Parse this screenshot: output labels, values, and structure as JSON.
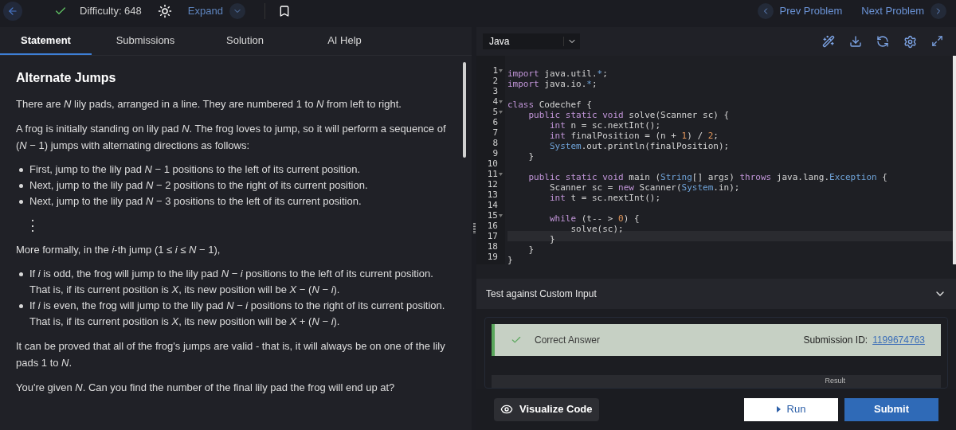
{
  "topbar": {
    "solved": true,
    "difficulty": "Difficulty: 648",
    "expand": "Expand",
    "prev": "Prev Problem",
    "next": "Next Problem"
  },
  "tabs": [
    {
      "label": "Statement",
      "selected": true
    },
    {
      "label": "Submissions",
      "selected": false
    },
    {
      "label": "Solution",
      "selected": false
    },
    {
      "label": "AI Help",
      "selected": false
    }
  ],
  "statement": {
    "title": "Alternate Jumps",
    "blocks": [
      {
        "kind": "p",
        "text": "There are *N* lily pads, arranged in a line. They are numbered 1 to *N* from left to right."
      },
      {
        "kind": "p",
        "text": "A frog is initially standing on lily pad *N*. The frog loves to jump, so it will perform a sequence of (*N* − 1) jumps with alternating directions as follows:"
      },
      {
        "kind": "list",
        "items": [
          "First, jump to the lily pad *N* − 1 positions to the left of its current position.",
          "Next, jump to the lily pad *N* − 2 positions to the right of its current position.",
          "Next, jump to the lily pad *N* − 3 positions to the left of its current position."
        ]
      },
      {
        "kind": "dots",
        "text": "⋮"
      },
      {
        "kind": "p",
        "text": "More formally, in the *i*-th jump (1 ≤ *i* ≤ *N* − 1),"
      },
      {
        "kind": "list",
        "items": [
          "If *i* is odd, the frog will jump to the lily pad *N* − *i* positions to the left of its current position. That is, if its current position is *X*, its new position will be *X* − (*N* − *i*).",
          "If *i* is even, the frog will jump to the lily pad *N* − *i* positions to the right of its current position. That is, if its current position is *X*, its new position will be *X* + (*N* − *i*)."
        ]
      },
      {
        "kind": "p",
        "text": "It can be proved that all of the frog's jumps are valid - that is, it will always be on one of the lily pads 1 to *N*."
      },
      {
        "kind": "p",
        "text": "You're given *N*. Can you find the number of the final lily pad the frog will end up at?"
      }
    ]
  },
  "editor": {
    "language": "Java",
    "lines": [
      {
        "n": "1",
        "fold": true,
        "current": false,
        "tokens": [
          {
            "kind": "kw",
            "t": "import"
          },
          {
            "kind": "plain",
            "t": " java.util."
          },
          {
            "kind": "type",
            "t": "*"
          },
          {
            "kind": "plain",
            "t": ";"
          }
        ]
      },
      {
        "n": "2",
        "fold": false,
        "current": false,
        "tokens": [
          {
            "kind": "kw",
            "t": "import"
          },
          {
            "kind": "plain",
            "t": " java.io."
          },
          {
            "kind": "type",
            "t": "*"
          },
          {
            "kind": "plain",
            "t": ";"
          }
        ]
      },
      {
        "n": "3",
        "fold": false,
        "current": false
      },
      {
        "n": "4",
        "fold": true,
        "current": false,
        "tokens": [
          {
            "kind": "kw",
            "t": "class"
          },
          {
            "kind": "plain",
            "t": " Codechef {"
          }
        ]
      },
      {
        "n": "5",
        "fold": true,
        "current": false,
        "tokens": [
          {
            "kind": "kw",
            "t": "    public static void"
          },
          {
            "kind": "plain",
            "t": " solve(Scanner sc) {"
          }
        ]
      },
      {
        "n": "6",
        "fold": false,
        "current": false,
        "tokens": [
          {
            "kind": "kw",
            "t": "        int"
          },
          {
            "kind": "plain",
            "t": " n = sc.nextInt();"
          }
        ]
      },
      {
        "n": "7",
        "fold": false,
        "current": false,
        "tokens": [
          {
            "kind": "kw",
            "t": "        int"
          },
          {
            "kind": "plain",
            "t": " finalPosition = (n + "
          },
          {
            "kind": "num",
            "t": "1"
          },
          {
            "kind": "plain",
            "t": ") / "
          },
          {
            "kind": "num",
            "t": "2"
          },
          {
            "kind": "plain",
            "t": ";"
          }
        ]
      },
      {
        "n": "8",
        "fold": false,
        "current": false,
        "tokens": [
          {
            "kind": "type",
            "t": "        System"
          },
          {
            "kind": "plain",
            "t": ".out.println(finalPosition);"
          }
        ]
      },
      {
        "n": "9",
        "fold": false,
        "current": false,
        "tokens": [
          {
            "kind": "plain",
            "t": "    }"
          }
        ]
      },
      {
        "n": "10",
        "fold": false,
        "current": false
      },
      {
        "n": "11",
        "fold": true,
        "current": false,
        "tokens": [
          {
            "kind": "kw",
            "t": "    public static void"
          },
          {
            "kind": "plain",
            "t": " main ("
          },
          {
            "kind": "type",
            "t": "String"
          },
          {
            "kind": "plain",
            "t": "[] args) "
          },
          {
            "kind": "kw",
            "t": "throws"
          },
          {
            "kind": "plain",
            "t": " java.lang."
          },
          {
            "kind": "type",
            "t": "Exception"
          },
          {
            "kind": "plain",
            "t": " {"
          }
        ]
      },
      {
        "n": "12",
        "fold": false,
        "current": false,
        "tokens": [
          {
            "kind": "plain",
            "t": "        Scanner sc = "
          },
          {
            "kind": "kw",
            "t": "new"
          },
          {
            "kind": "plain",
            "t": " Scanner("
          },
          {
            "kind": "type",
            "t": "System"
          },
          {
            "kind": "plain",
            "t": ".in);"
          }
        ]
      },
      {
        "n": "13",
        "fold": false,
        "current": false,
        "tokens": [
          {
            "kind": "kw",
            "t": "        int"
          },
          {
            "kind": "plain",
            "t": " t = sc.nextInt();"
          }
        ]
      },
      {
        "n": "14",
        "fold": false,
        "current": false
      },
      {
        "n": "15",
        "fold": true,
        "current": false,
        "tokens": [
          {
            "kind": "kw",
            "t": "        while"
          },
          {
            "kind": "plain",
            "t": " (t-- > "
          },
          {
            "kind": "num",
            "t": "0"
          },
          {
            "kind": "plain",
            "t": ") {"
          }
        ]
      },
      {
        "n": "16",
        "fold": false,
        "current": false,
        "tokens": [
          {
            "kind": "plain",
            "t": "            solve(sc);"
          }
        ]
      },
      {
        "n": "17",
        "fold": false,
        "current": true,
        "tokens": [
          {
            "kind": "plain",
            "t": "        }"
          }
        ]
      },
      {
        "n": "18",
        "fold": false,
        "current": false,
        "tokens": [
          {
            "kind": "plain",
            "t": "    }"
          }
        ]
      },
      {
        "n": "19",
        "fold": false,
        "current": false,
        "tokens": [
          {
            "kind": "plain",
            "t": "}"
          }
        ]
      }
    ]
  },
  "custom_input": {
    "label": "Test against Custom Input",
    "expanded": false
  },
  "result": {
    "verdict": "Correct Answer",
    "correct": true,
    "id_label": "Submission ID:",
    "id": "1199674763",
    "table_header": "Result"
  },
  "actions": {
    "visualize": "Visualize Code",
    "run": "Run",
    "submit": "Submit"
  }
}
